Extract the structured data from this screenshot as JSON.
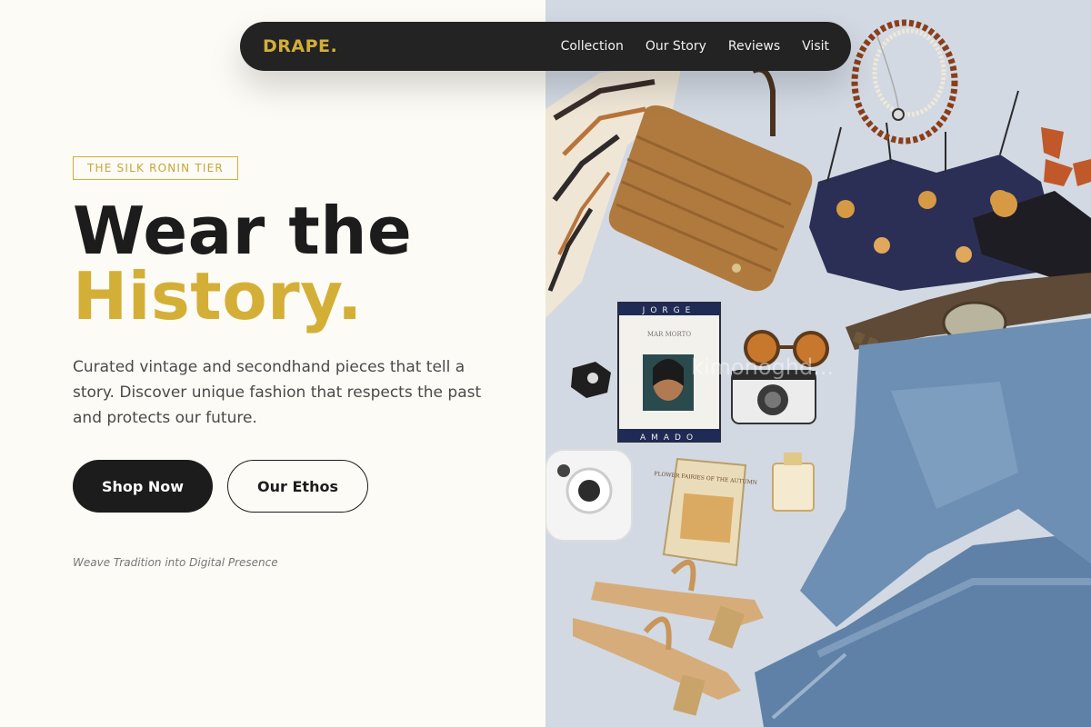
{
  "nav": {
    "logo": "DRAPE.",
    "links": [
      "Collection",
      "Our Story",
      "Reviews",
      "Visit"
    ]
  },
  "hero": {
    "badge": "THE SILK RONIN TIER",
    "title_line1": "Wear the",
    "title_line2": "History.",
    "description": "Curated vintage and secondhand pieces that tell a story. Discover unique fashion that respects the past and protects our future.",
    "primary_button": "Shop Now",
    "secondary_button": "Our Ethos",
    "tagline": "Weave Tradition into Digital Presence"
  },
  "photo": {
    "book_top": "JORGE",
    "book_mid": "MAR MORTO",
    "book_bottom": "AMADO",
    "book2_title": "FLOWER FAIRIES OF THE AUTUMN",
    "watermark": "kimonoghd..."
  },
  "colors": {
    "accent": "#d4af37",
    "dark": "#1c1c1c",
    "background": "#fcfbf5",
    "nav_bg": "#232323"
  }
}
